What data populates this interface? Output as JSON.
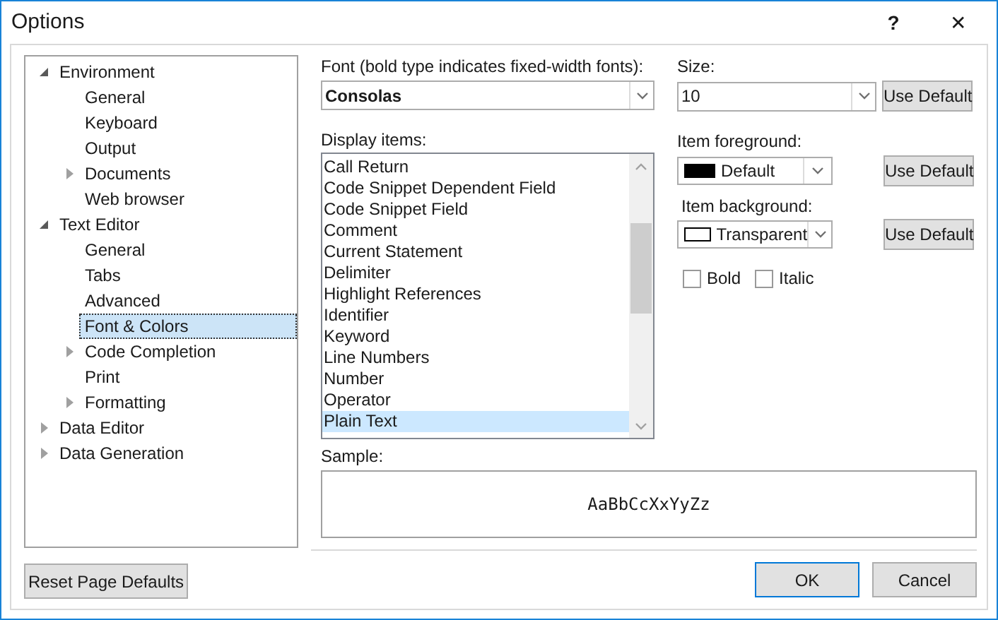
{
  "window": {
    "title": "Options",
    "help": "?",
    "close": "✕"
  },
  "tree": [
    {
      "label": "Environment",
      "expanded": true,
      "selected": false,
      "children": [
        {
          "label": "General",
          "selected": false
        },
        {
          "label": "Keyboard",
          "selected": false
        },
        {
          "label": "Output",
          "selected": false
        },
        {
          "label": "Documents",
          "expanded": false,
          "selected": false
        },
        {
          "label": "Web browser",
          "selected": false
        }
      ]
    },
    {
      "label": "Text Editor",
      "expanded": true,
      "selected": false,
      "children": [
        {
          "label": "General",
          "selected": false
        },
        {
          "label": "Tabs",
          "selected": false
        },
        {
          "label": "Advanced",
          "selected": false
        },
        {
          "label": "Font & Colors",
          "selected": true
        },
        {
          "label": "Code Completion",
          "expanded": false,
          "selected": false
        },
        {
          "label": "Print",
          "selected": false
        },
        {
          "label": "Formatting",
          "expanded": false,
          "selected": false
        }
      ]
    },
    {
      "label": "Data Editor",
      "expanded": false,
      "selected": false
    },
    {
      "label": "Data Generation",
      "expanded": false,
      "selected": false
    }
  ],
  "reset_button": "Reset Page Defaults",
  "font": {
    "label": "Font (bold type indicates fixed-width fonts):",
    "value": "Consolas"
  },
  "size": {
    "label": "Size:",
    "value": "10",
    "button": "Use Default"
  },
  "display_items": {
    "label": "Display items:",
    "items": [
      {
        "label": "Call Return",
        "selected": false
      },
      {
        "label": "Code Snippet Dependent Field",
        "selected": false
      },
      {
        "label": "Code Snippet Field",
        "selected": false
      },
      {
        "label": "Comment",
        "selected": false
      },
      {
        "label": "Current Statement",
        "selected": false
      },
      {
        "label": "Delimiter",
        "selected": false
      },
      {
        "label": "Highlight References",
        "selected": false
      },
      {
        "label": "Identifier",
        "selected": false
      },
      {
        "label": "Keyword",
        "selected": false
      },
      {
        "label": "Line Numbers",
        "selected": false
      },
      {
        "label": "Number",
        "selected": false
      },
      {
        "label": "Operator",
        "selected": false
      },
      {
        "label": "Plain Text",
        "selected": true
      }
    ]
  },
  "item_foreground": {
    "label": "Item foreground:",
    "value": "Default",
    "color": "#000000",
    "button": "Use Default"
  },
  "item_background": {
    "label": "Item background:",
    "value": "Transparent",
    "color": "#ffffff",
    "button": "Use Default"
  },
  "checkboxes": [
    {
      "label": "Bold",
      "checked": false
    },
    {
      "label": "Italic",
      "checked": false
    }
  ],
  "sample": {
    "label": "Sample:",
    "text": "AaBbCcXxYyZz"
  },
  "buttons": [
    {
      "label": "OK",
      "kind": "default"
    },
    {
      "label": "Cancel",
      "kind": "normal"
    }
  ]
}
